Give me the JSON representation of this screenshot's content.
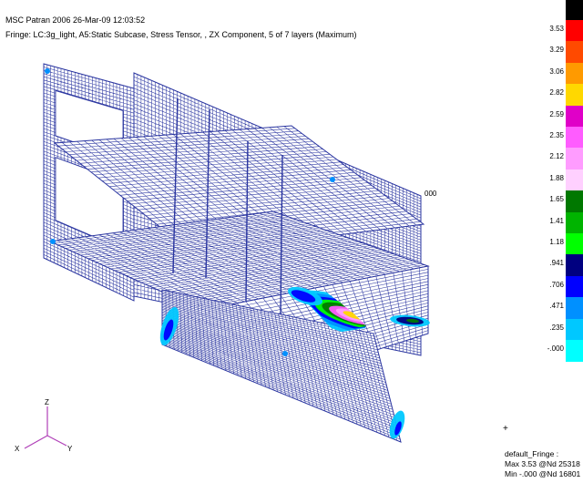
{
  "header": {
    "title": "MSC Patran 2006 26-Mar-09 12:03:52",
    "fringe_description": "Fringe: LC:3g_light, A5:Static Subcase, Stress Tensor, , ZX Component, 5 of 7 layers (Maximum)"
  },
  "model": {
    "mesh_color": "#2a35a0",
    "node_label": "000"
  },
  "triad": {
    "z_label": "Z",
    "x_label": "X",
    "y_label": "Y",
    "color": "#b040b8"
  },
  "legend": {
    "labels": [
      "3.53",
      "3.29",
      "3.06",
      "2.82",
      "2.59",
      "2.35",
      "2.12",
      "1.88",
      "1.65",
      "1.41",
      "1.18",
      ".941",
      ".706",
      ".471",
      ".235",
      "-.000"
    ],
    "colors": [
      "#000000",
      "#ff0000",
      "#ff4a00",
      "#ff9a00",
      "#ffd800",
      "#e000c8",
      "#ff5cff",
      "#ff9cff",
      "#ffd0ff",
      "#007800",
      "#00b400",
      "#00ff00",
      "#000080",
      "#0000ff",
      "#0090ff",
      "#00c8ff",
      "#00ffff"
    ]
  },
  "footer": {
    "fringe_name": "default_Fringe :",
    "max_line": "Max 3.53 @Nd 25318",
    "min_line": "Min -.000 @Nd 16801"
  },
  "cursor_marker": "+"
}
